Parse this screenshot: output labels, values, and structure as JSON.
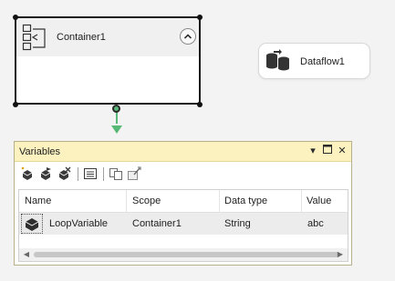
{
  "canvas": {
    "container_task": {
      "title": "Container1"
    },
    "dataflow_task": {
      "title": "Dataflow1"
    }
  },
  "variables_window": {
    "title": "Variables",
    "columns": [
      "Name",
      "Scope",
      "Data type",
      "Value"
    ],
    "rows": [
      {
        "name": "LoopVariable",
        "scope": "Container1",
        "data_type": "String",
        "value": "abc"
      }
    ]
  },
  "colors": {
    "window_title_bg": "#fbf2c0",
    "connector": "#58b878"
  },
  "icons": {
    "container": "container-icon",
    "dataflow": "dataflow-icon",
    "collapse": "chevron-up-icon",
    "dropdown": "dropdown-arrow-icon",
    "restore": "restore-window-icon",
    "close": "close-icon",
    "row": "variable-icon"
  }
}
